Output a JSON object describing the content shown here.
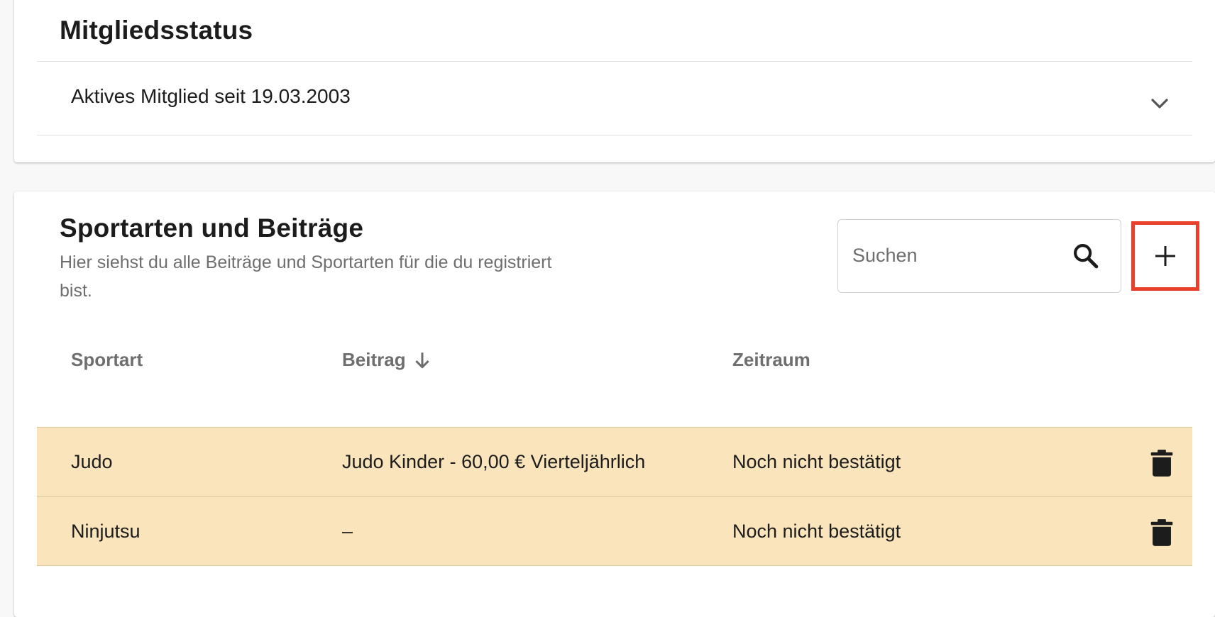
{
  "status_section": {
    "title": "Mitgliedsstatus",
    "membership_text": "Aktives Mitglied seit 19.03.2003"
  },
  "sports_section": {
    "title": "Sportarten und Beiträge",
    "subtitle": "Hier siehst du alle Beiträge und Sportarten für die du registriert bist.",
    "search": {
      "placeholder": "Suchen",
      "value": ""
    },
    "add_button_icon": "plus-icon",
    "columns": [
      "Sportart",
      "Beitrag",
      "Zeitraum"
    ],
    "sort_column": "Beitrag",
    "sort_direction": "descending",
    "rows": [
      {
        "sport": "Judo",
        "fee": "Judo Kinder - 60,00 € Vierteljährlich",
        "period": "Noch nicht bestätigt"
      },
      {
        "sport": "Ninjutsu",
        "fee": "–",
        "period": "Noch nicht bestätigt"
      }
    ]
  },
  "colors": {
    "row_highlight": "#fae4bc",
    "add_button_border": "#e8402a",
    "muted_text": "#6e6e6e"
  }
}
